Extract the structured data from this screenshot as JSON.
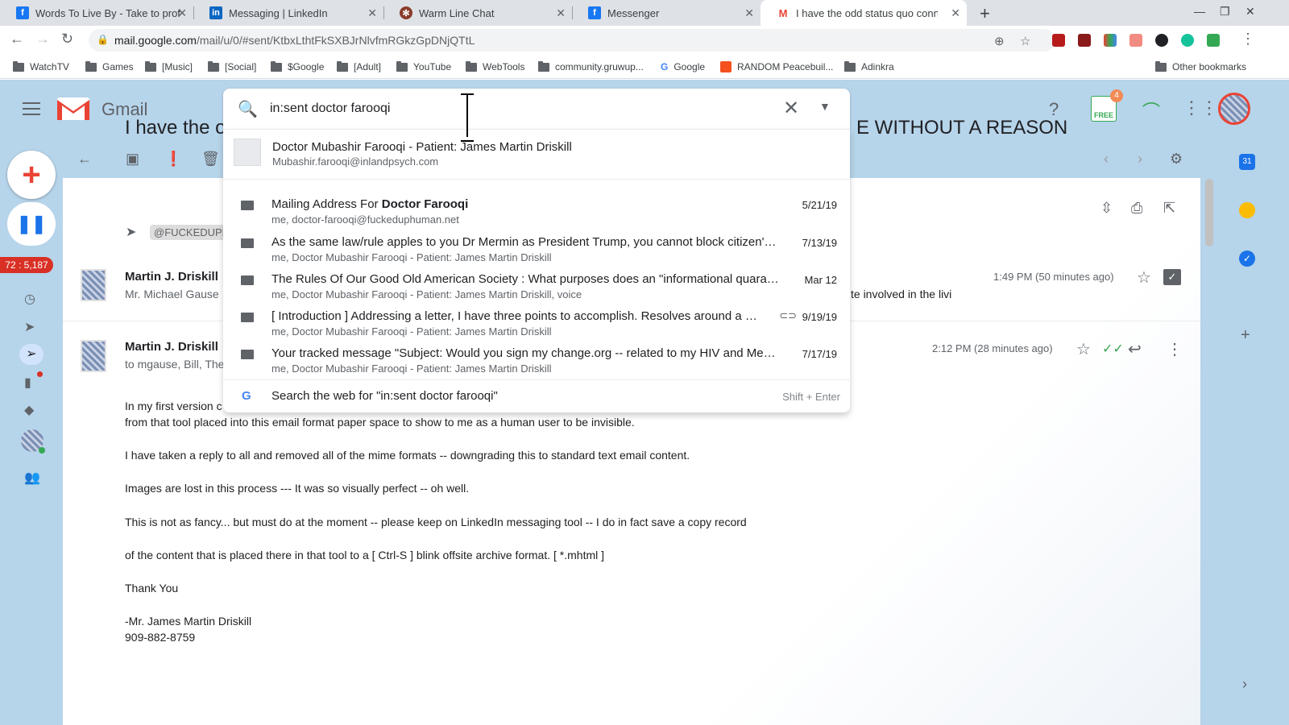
{
  "browser": {
    "tabs": [
      {
        "title": "Words To Live By - Take to profes",
        "icon": "facebook-icon",
        "color": "#1877f2"
      },
      {
        "title": "Messaging | LinkedIn",
        "icon": "linkedin-icon",
        "color": "#0a66c2"
      },
      {
        "title": "Warm Line Chat",
        "icon": "chat-icon",
        "color": "#8a3b2a"
      },
      {
        "title": "Messenger",
        "icon": "facebook-icon",
        "color": "#1877f2"
      },
      {
        "title": "I have the odd status quo conne",
        "icon": "gmail-icon",
        "color": "#ea4335"
      }
    ],
    "url_host": "mail.google.com",
    "url_path": "/mail/u/0/#sent/KtbxLthtFkSXBJrNlvfmRGkzGpDNjQTtL",
    "bookmarks": [
      "WatchTV",
      "Games",
      "[Music]",
      "[Social]",
      "$Google",
      "[Adult]",
      "YouTube",
      "WebTools",
      "community.gruwup...",
      "Google",
      "RANDOM Peacebuil...",
      "Adinkra"
    ],
    "other_bookmarks": "Other bookmarks"
  },
  "gmail": {
    "logo_text": "Gmail",
    "notification_count": "4",
    "free_badge": "FREE",
    "counter_badge": "72 : 5,187",
    "search": {
      "query": "in:sent doctor farooqi"
    },
    "contact_suggestion": {
      "name": "Doctor Mubashir Farooqi - Patient: James Martin Driskill",
      "email": "Mubashir.farooqi@inlandpsych.com"
    },
    "suggestions": [
      {
        "title_prefix": "Mailing Address For ",
        "title_bold": "Doctor Farooqi",
        "sub": "me, doctor-farooqi@fuckeduphuman.net",
        "date": "5/21/19",
        "attachment": false
      },
      {
        "title_prefix": "As the same law/rule apples to you Dr Mermin as President Trump, you cannot block citizen's fr...",
        "title_bold": "",
        "sub": "me, Doctor Mubashir Farooqi - Patient: James Martin Driskill",
        "date": "7/13/19",
        "attachment": false
      },
      {
        "title_prefix": "The Rules Of Our Good Old American Society : What purposes does an \"informational quarantin...",
        "title_bold": "",
        "sub": "me, Doctor Mubashir Farooqi - Patient: James Martin Driskill, voice",
        "date": "Mar 12",
        "attachment": false
      },
      {
        "title_prefix": "[ Introduction ] Addressing a letter, I have three points to accomplish. Resolves around a men...",
        "title_bold": "",
        "sub": "me, Doctor Mubashir Farooqi - Patient: James Martin Driskill",
        "date": "9/19/19",
        "attachment": true
      },
      {
        "title_prefix": "Your tracked message \"Subject: Would you sign my change.org -- related to my HIV and Mental ...",
        "title_bold": "",
        "sub": "me, Doctor Mubashir Farooqi - Patient: James Martin Driskill",
        "date": "7/17/19",
        "attachment": false
      }
    ],
    "web_search": {
      "label": "Search the web for \"in:sent doctor farooqi\"",
      "shortcut": "Shift + Enter"
    },
    "thread": {
      "subject_left": "I have the o",
      "subject_right": "E WITHOUT A REASON",
      "label_chip": "@FUCKEDUPH",
      "messages": [
        {
          "sender": "Martin J. Driskill",
          "snippet": "Mr. Michael Gause",
          "snippet_right": "te involved in the livi",
          "time": "1:49 PM (50 minutes ago)"
        },
        {
          "sender": "Martin J. Driskill",
          "snippet": "to mgause, Bill, The",
          "time": "2:12 PM (28 minutes ago)"
        }
      ],
      "body": [
        "In my first version c",
        "from that tool placed into this email format paper space to show to me as a human user to be invisible.",
        "I have taken a reply to all and removed all of the mime formats -- downgrading this to standard text email content.",
        "Images are lost in this process --- It was so visually perfect -- oh well.",
        "This is not as fancy... but must do at the moment -- please keep on LinkedIn messaging tool -- I do in fact save a copy record",
        "of the content that is placed there in that tool to a [ Ctrl-S ] blink offsite archive format.  [ *.mhtml ]",
        "Thank You",
        "-Mr. James Martin Driskill",
        "909-882-8759"
      ]
    }
  }
}
